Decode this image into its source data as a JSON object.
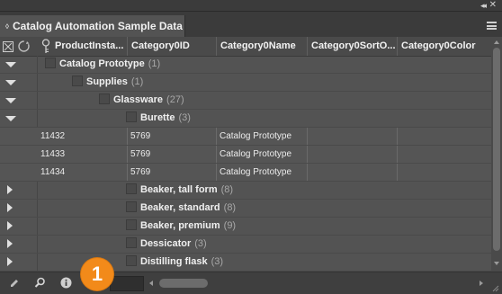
{
  "panel": {
    "title": "Catalog Automation Sample Data",
    "collapse_glyph": "◂◂",
    "close_glyph": "✕"
  },
  "columns": [
    "ProductInsta...",
    "Category0ID",
    "Category0Name",
    "Category0SortO...",
    "Category0Color"
  ],
  "groups": [
    {
      "label": "Catalog Prototype",
      "count": "(1)",
      "expanded": true
    },
    {
      "label": "Supplies",
      "count": "(1)",
      "expanded": true
    },
    {
      "label": "Glassware",
      "count": "(27)",
      "expanded": true
    },
    {
      "label": "Burette",
      "count": "(3)",
      "expanded": true
    }
  ],
  "data_rows": [
    {
      "product": "11432",
      "category_id": "5769",
      "category_name": "Catalog Prototype",
      "sort": "",
      "color": ""
    },
    {
      "product": "11433",
      "category_id": "5769",
      "category_name": "Catalog Prototype",
      "sort": "",
      "color": ""
    },
    {
      "product": "11434",
      "category_id": "5769",
      "category_name": "Catalog Prototype",
      "sort": "",
      "color": ""
    }
  ],
  "collapsed_groups": [
    {
      "label": "Beaker, tall form",
      "count": "(8)"
    },
    {
      "label": "Beaker, standard",
      "count": "(8)"
    },
    {
      "label": "Beaker, premium",
      "count": "(9)"
    },
    {
      "label": "Dessicator",
      "count": "(3)"
    },
    {
      "label": "Distilling flask",
      "count": "(3)"
    }
  ],
  "callout": {
    "number": "1"
  },
  "colors": {
    "callout": "#f28a1a",
    "panel_bg": "#535353"
  }
}
